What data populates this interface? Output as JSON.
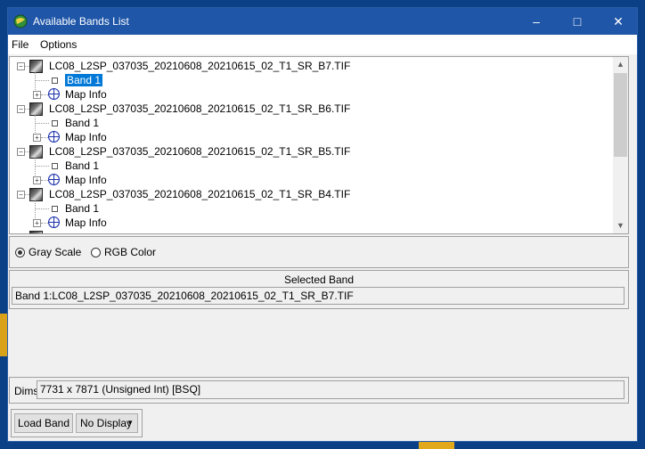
{
  "window": {
    "title": "Available Bands List"
  },
  "menu": {
    "file": "File",
    "options": "Options"
  },
  "tree": {
    "files": [
      {
        "name": "LC08_L2SP_037035_20210608_20210615_02_T1_SR_B7.TIF",
        "band": "Band 1",
        "map": "Map Info",
        "band_selected": true
      },
      {
        "name": "LC08_L2SP_037035_20210608_20210615_02_T1_SR_B6.TIF",
        "band": "Band 1",
        "map": "Map Info",
        "band_selected": false
      },
      {
        "name": "LC08_L2SP_037035_20210608_20210615_02_T1_SR_B5.TIF",
        "band": "Band 1",
        "map": "Map Info",
        "band_selected": false
      },
      {
        "name": "LC08_L2SP_037035_20210608_20210615_02_T1_SR_B4.TIF",
        "band": "Band 1",
        "map": "Map Info",
        "band_selected": false
      }
    ]
  },
  "mode": {
    "gray": "Gray Scale",
    "rgb": "RGB Color",
    "selected": "gray"
  },
  "selected_band": {
    "header": "Selected Band",
    "value": "Band 1:LC08_L2SP_037035_20210608_20210615_02_T1_SR_B7.TIF"
  },
  "dims": {
    "label": "Dims",
    "value": "7731 x 7871 (Unsigned Int) [BSQ]"
  },
  "footer": {
    "load_band": "Load Band",
    "display": "No Display"
  },
  "colors": {
    "titlebar": "#1f56a8",
    "selection": "#0078d7",
    "desktop": "#0b3f86"
  }
}
